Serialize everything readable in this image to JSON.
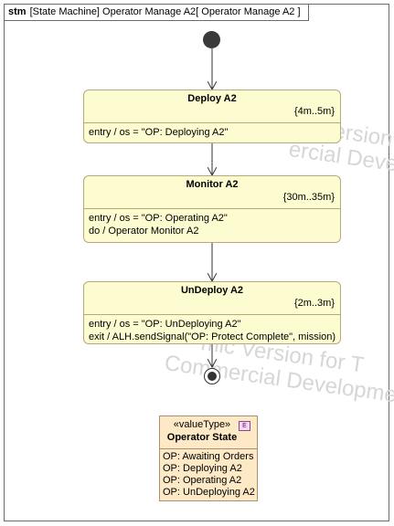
{
  "frame": {
    "keyword": "stm",
    "title": "[State Machine] Operator Manage A2[ Operator Manage A2 ]"
  },
  "watermark": {
    "lines": [
      "Version",
      "ercial Deve",
      "mic Version for T",
      "Commercial Developme"
    ]
  },
  "states": [
    {
      "name": "Deploy A2",
      "duration": "{4m..5m}",
      "behaviors": [
        "entry / os = \"OP: Deploying A2\""
      ]
    },
    {
      "name": "Monitor A2",
      "duration": "{30m..35m}",
      "behaviors": [
        "entry / os = \"OP: Operating A2\"",
        "do / Operator Monitor A2"
      ]
    },
    {
      "name": "UnDeploy A2",
      "duration": "{2m..3m}",
      "behaviors": [
        "entry / os = \"OP: UnDeploying A2\"",
        "exit / ALH.sendSignal(\"OP: Protect Complete\", mission)"
      ]
    }
  ],
  "enumeration": {
    "stereotype": "«valueType»",
    "name": "Operator State",
    "badge": "E",
    "literals": [
      "OP: Awaiting Orders",
      "OP: Deploying A2",
      "OP: Operating A2",
      "OP: UnDeploying A2"
    ]
  }
}
